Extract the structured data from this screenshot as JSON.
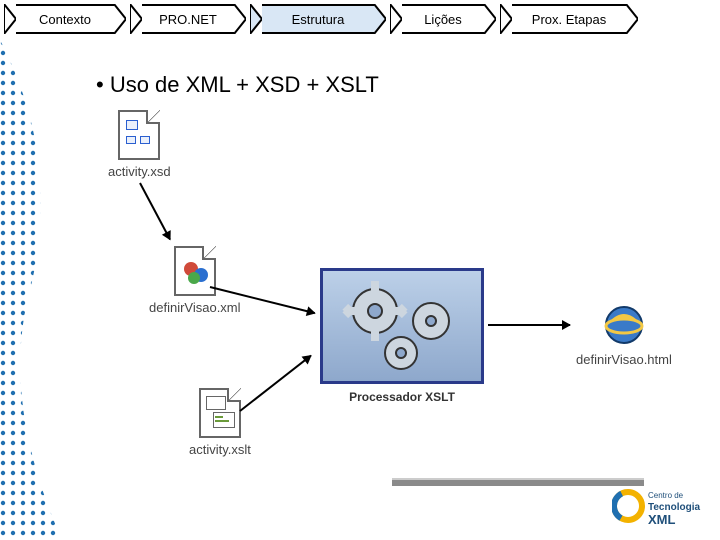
{
  "nav": {
    "items": [
      {
        "label": "Contexto",
        "active": false
      },
      {
        "label": "PRO.NET",
        "active": false
      },
      {
        "label": "Estrutura",
        "active": true
      },
      {
        "label": "Lições",
        "active": false
      },
      {
        "label": "Prox. Etapas",
        "active": false
      }
    ]
  },
  "heading": "• Uso de XML + XSD + XSLT",
  "diagram": {
    "xsd_label": "activity.xsd",
    "xml_label": "definirVisao.xml",
    "xslt_label": "activity.xslt",
    "html_label": "definirVisao.html",
    "processor_label": "Processador XSLT"
  },
  "logo": {
    "top_text": "Centro de",
    "mid_text": "Tecnologia",
    "bottom_text": "XML"
  }
}
